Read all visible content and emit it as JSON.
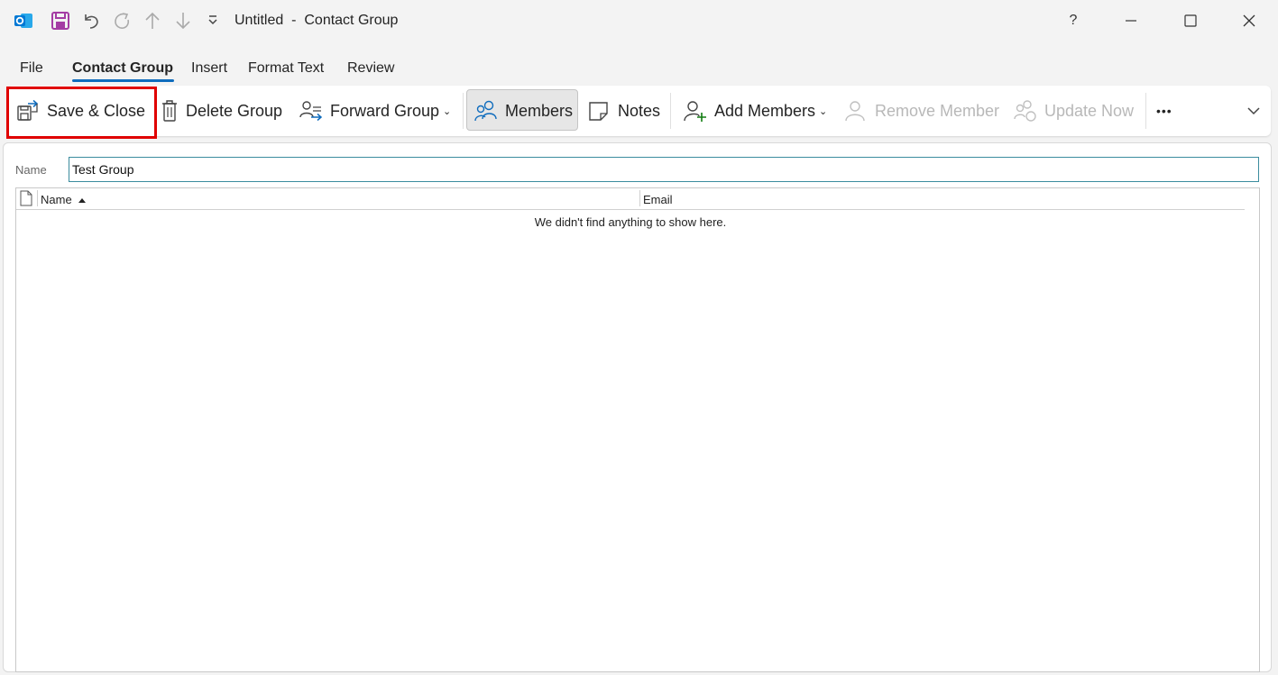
{
  "window": {
    "title": "Untitled  -  Contact Group",
    "help": "?",
    "quick_access": [
      "outlook-logo",
      "save-icon",
      "undo-icon",
      "redo-icon",
      "up-arrow-icon",
      "down-arrow-icon",
      "customize-dropdown-icon"
    ]
  },
  "tabs": [
    {
      "label": "File"
    },
    {
      "label": "Contact Group",
      "active": true
    },
    {
      "label": "Insert"
    },
    {
      "label": "Format Text"
    },
    {
      "label": "Review"
    }
  ],
  "ribbon": {
    "save_close": "Save & Close",
    "delete_group": "Delete Group",
    "forward_group": "Forward Group",
    "members": "Members",
    "notes": "Notes",
    "add_members": "Add Members",
    "remove_member": "Remove Member",
    "update_now": "Update Now",
    "more": "•••"
  },
  "form": {
    "name_label": "Name",
    "name_value": "Test Group"
  },
  "members_list": {
    "columns": [
      {
        "label": "Name",
        "sort": "ascending"
      },
      {
        "label": "Email"
      }
    ],
    "empty_message": "We didn't find anything to show here."
  },
  "colors": {
    "accent": "#0f6cbd",
    "highlight": "#e00000",
    "outlook_blue": "#0078d4",
    "save_purple": "#a43ca4"
  }
}
